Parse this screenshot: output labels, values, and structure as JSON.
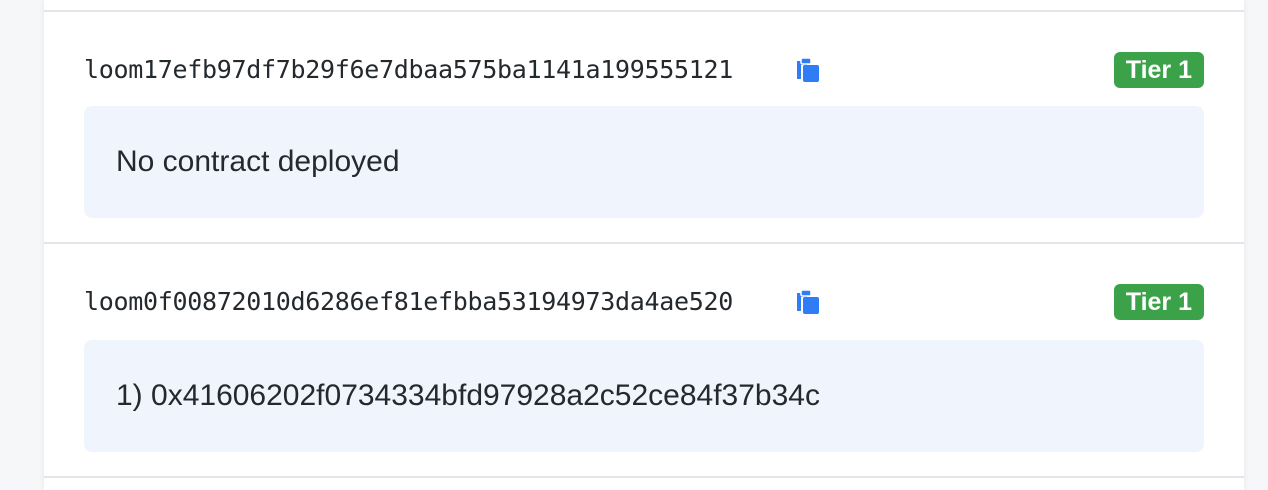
{
  "accounts": [
    {
      "address": "loom17efb97df7b29f6e7dbaa575ba1141a199555121",
      "copy_icon": "clipboard-copy-icon",
      "tier": "Tier 1",
      "contracts_text": "No contract deployed"
    },
    {
      "address": "loom0f00872010d6286ef81efbba53194973da4ae520",
      "copy_icon": "clipboard-copy-icon",
      "tier": "Tier 1",
      "contracts_text": "1) 0x41606202f0734334bfd97928a2c52ce84f37b34c"
    }
  ],
  "colors": {
    "tier_badge": "#3ca24a",
    "copy_icon": "#2f7cf6",
    "contract_box": "#eff4fd"
  }
}
